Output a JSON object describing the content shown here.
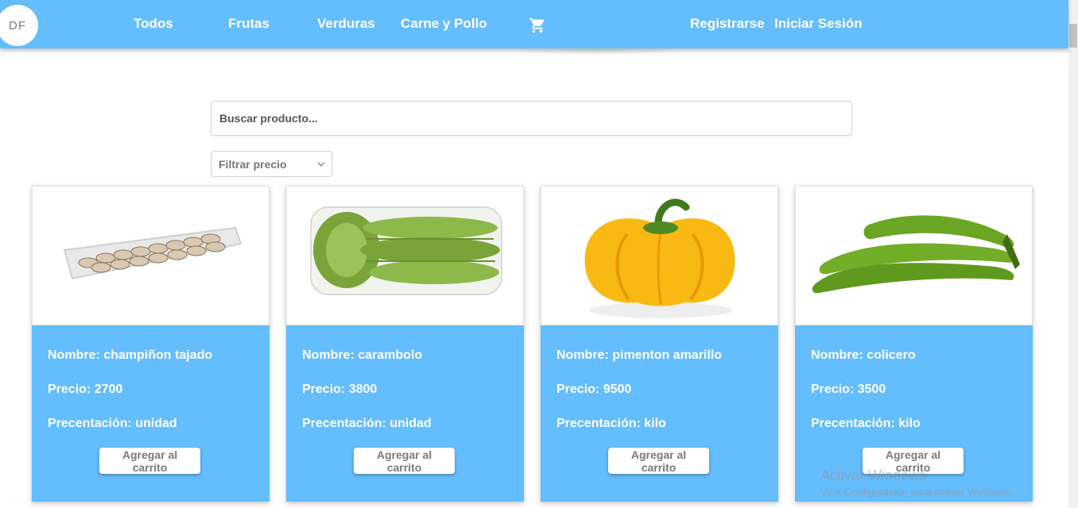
{
  "logo": "DF",
  "nav": {
    "links": [
      "Todos",
      "Frutas",
      "Verduras",
      "Carne y Pollo"
    ],
    "auth": [
      "Registrarse",
      "Iniciar Sesión"
    ],
    "cart_icon": "shopping-cart-icon"
  },
  "search": {
    "placeholder": "Buscar producto..."
  },
  "filter": {
    "label": "Filtrar precio"
  },
  "products": [
    {
      "nombre": "Nombre: champiñon tajado",
      "precio": "Precio: 2700",
      "presentacion": "Precentación: unidad",
      "button": "Agregar al carrito",
      "image": "sliced-mushrooms-tray"
    },
    {
      "nombre": "Nombre: carambolo",
      "precio": "Precio: 3800",
      "presentacion": "Precentación: unidad",
      "button": "Agregar al carrito",
      "image": "starfruit-tray"
    },
    {
      "nombre": "Nombre: pimenton amarillo",
      "precio": "Precio: 9500",
      "presentacion": "Precentación: kilo",
      "button": "Agregar al carrito",
      "image": "yellow-bell-pepper"
    },
    {
      "nombre": "Nombre: colicero",
      "precio": "Precio: 3500",
      "presentacion": "Precentación: kilo",
      "button": "Agregar al carrito",
      "image": "green-plantains"
    }
  ],
  "watermark": {
    "title": "Activar Windows",
    "subtitle": "Ve a Configuración para activar Windows."
  },
  "colors": {
    "primary": "#64bdfd",
    "white": "#ffffff",
    "button_text": "#7a7a7a"
  }
}
